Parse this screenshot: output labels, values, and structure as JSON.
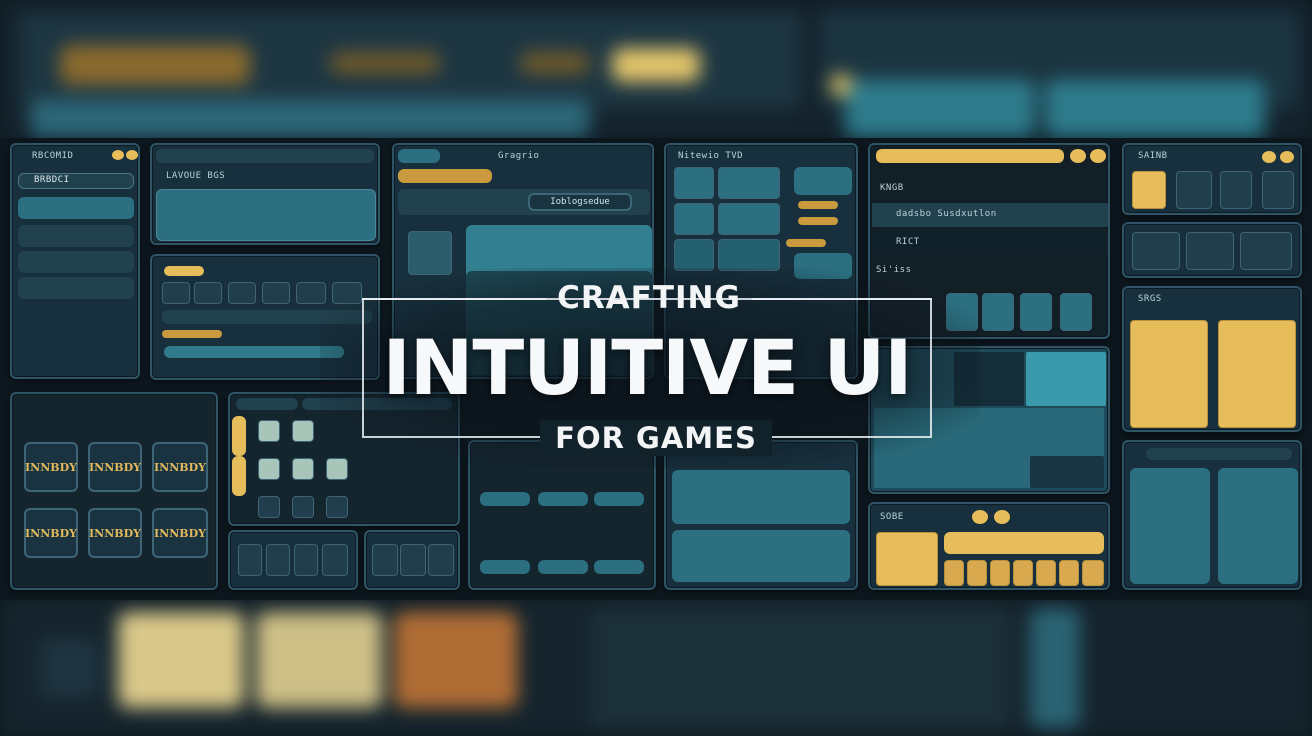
{
  "title": {
    "line1": "CRAFTING",
    "line2": "INTUITIVE UI",
    "line3": "FOR GAMES"
  },
  "panels": {
    "p1_header": "RBCOMID",
    "p1_field": "BRBDCI",
    "p2_header": "LAVOUE BGS",
    "p3_header": "Gragrio",
    "p3_button": "Ioblogsedue",
    "p4_header": "Nitewio TVD",
    "p5_list_head": "KNGB",
    "p5_item1": "dadsbo Susdxutlon",
    "p5_item2": "RICT",
    "p5_list_head2": "Si'iss",
    "p6_header": "SAINB",
    "p7_header": "SRGS",
    "p8_header": "SOBE",
    "inventory_label": "INNBDY"
  },
  "colors": {
    "gold": "#e6bd5a",
    "teal": "#2b6f80",
    "panel_bg": "#18303d",
    "border": "#2f5466"
  }
}
